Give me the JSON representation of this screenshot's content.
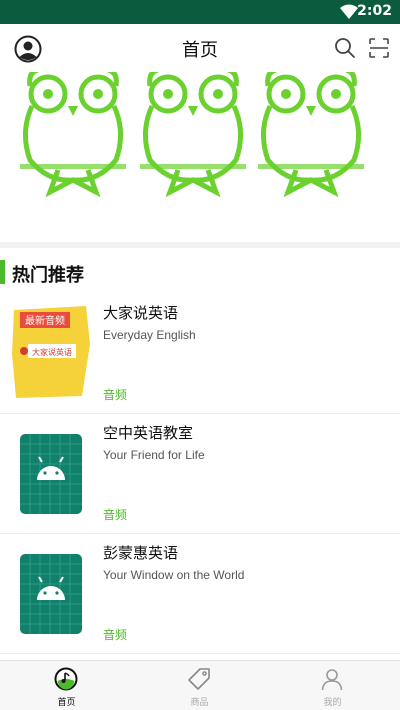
{
  "status_bar": {
    "time": "2:02"
  },
  "app_bar": {
    "title": "首页"
  },
  "section": {
    "title": "热门推荐"
  },
  "items": [
    {
      "name": "大家说英语",
      "subtitle": "Everyday English",
      "tag": "音频",
      "cover_text_top": "最新音频",
      "cover_text_mid": "大家说英语"
    },
    {
      "name": "空中英语教室",
      "subtitle": "Your Friend for Life",
      "tag": "音频"
    },
    {
      "name": "彭蒙惠英语",
      "subtitle": "Your Window on the World",
      "tag": "音频"
    }
  ],
  "bottom_nav": [
    {
      "label": "首页",
      "active": true
    },
    {
      "label": "商品",
      "active": false
    },
    {
      "label": "我的",
      "active": false
    }
  ],
  "colors": {
    "status_bar": "#0b5c3f",
    "accent": "#4cba2a",
    "inactive": "#aaaaaa"
  }
}
